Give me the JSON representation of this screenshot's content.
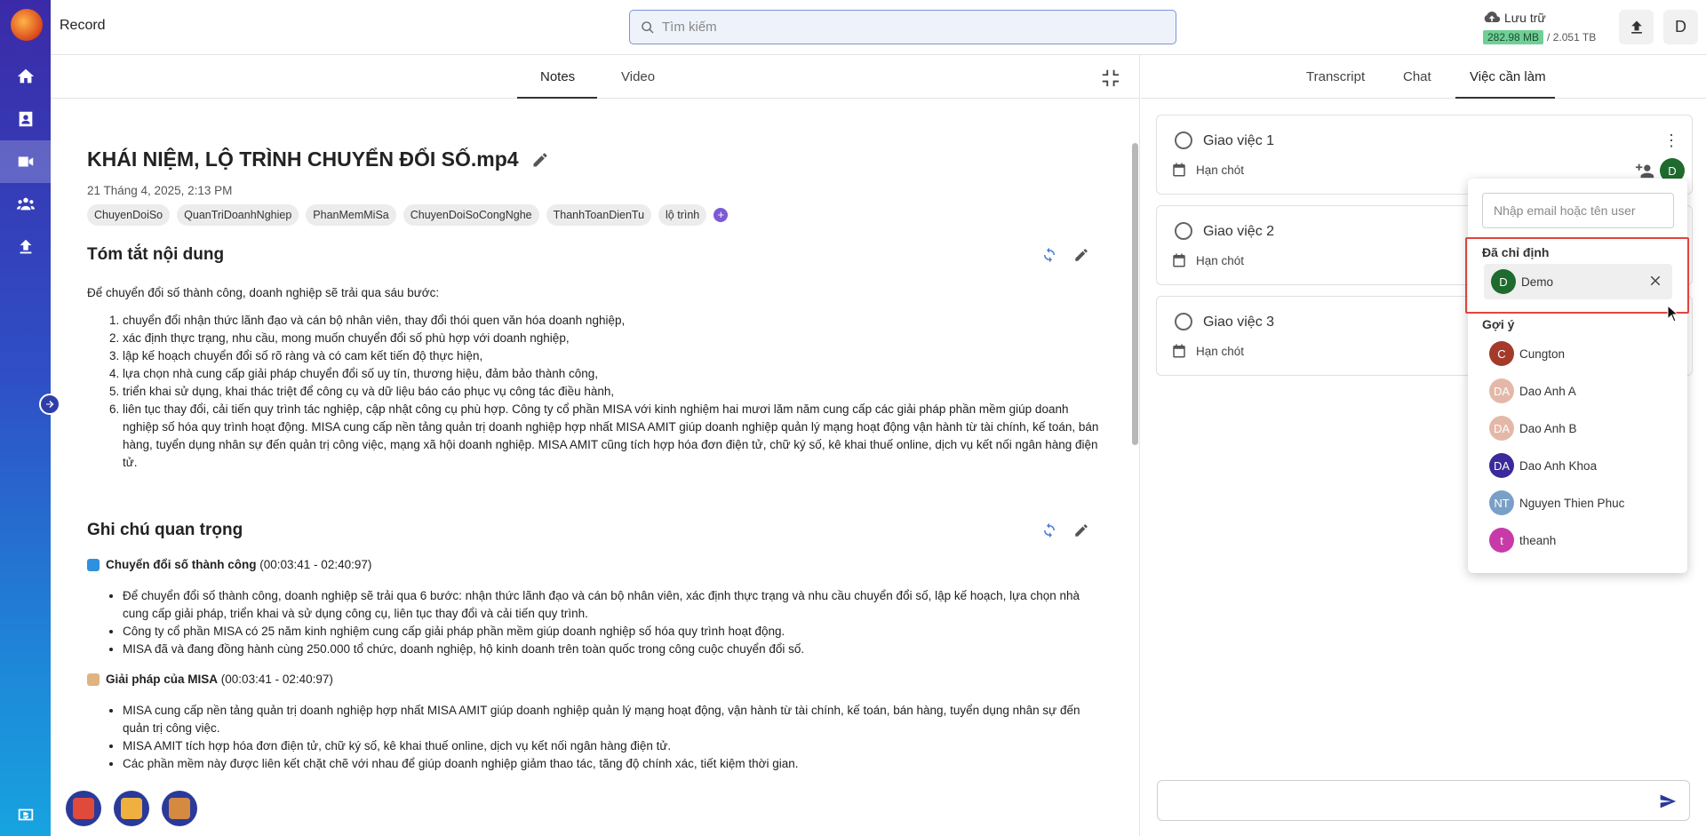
{
  "app": {
    "title": "Record"
  },
  "search": {
    "placeholder": "Tìm kiếm"
  },
  "storage": {
    "label": "Lưu trữ",
    "used": "282.98 MB",
    "total": "/ 2.051 TB"
  },
  "header": {
    "user_initial": "D"
  },
  "left_tabs": [
    {
      "label": "Notes"
    },
    {
      "label": "Video"
    }
  ],
  "right_tabs": [
    {
      "label": "Transcript"
    },
    {
      "label": "Chat"
    },
    {
      "label": "Việc cần làm"
    }
  ],
  "doc": {
    "title": "KHÁI NIỆM, LỘ TRÌNH CHUYỂN ĐỔI SỐ.mp4",
    "date": "21 Tháng 4, 2025, 2:13 PM",
    "tags": [
      "ChuyenDoiSo",
      "QuanTriDoanhNghiep",
      "PhanMemMiSa",
      "ChuyenDoiSoCongNghe",
      "ThanhToanDienTu",
      "lộ trình"
    ]
  },
  "summary": {
    "heading": "Tóm tắt nội dung",
    "intro": "Để chuyển đổi số thành công, doanh nghiệp sẽ trải qua sáu bước:",
    "steps": [
      "chuyển đổi nhận thức lãnh đạo và cán bộ nhân viên, thay đổi thói quen văn hóa doanh nghiệp,",
      "xác định thực trạng, nhu cầu, mong muốn chuyển đổi số phù hợp với doanh nghiệp,",
      "lập kế hoạch chuyển đổi số rõ ràng và có cam kết tiến độ thực hiện,",
      "lựa chọn nhà cung cấp giải pháp chuyển đổi số uy tín, thương hiệu, đảm bảo thành công,",
      "triển khai sử dụng, khai thác triệt để công cụ và dữ liệu báo cáo phục vụ công tác điều hành,",
      "liên tục thay đổi, cải tiến quy trình tác nghiệp, cập nhật công cụ phù hợp. Công ty cổ phần MISA với kinh nghiệm hai mươi lăm năm cung cấp các giải pháp phần mềm giúp doanh nghiệp số hóa quy trình hoạt động. MISA cung cấp nền tảng quản trị doanh nghiệp hợp nhất MISA AMIT giúp doanh nghiệp quản lý mạng hoạt động vận hành từ tài chính, kế toán, bán hàng, tuyển dụng nhân sự đến quản trị công việc, mạng xã hội doanh nghiệp. MISA AMIT cũng tích hợp hóa đơn điện tử, chữ ký số, kê khai thuế online, dịch vụ kết nối ngân hàng điện tử."
    ]
  },
  "notes": {
    "heading": "Ghi chú quan trọng",
    "sections": [
      {
        "title": "Chuyển đổi số thành công",
        "time": "(00:03:41 - 02:40:97)",
        "bullets": [
          "Để chuyển đổi số thành công, doanh nghiệp sẽ trải qua 6 bước: nhận thức lãnh đạo và cán bộ nhân viên, xác định thực trạng và nhu cầu chuyển đổi số, lập kế hoạch, lựa chọn nhà cung cấp giải pháp, triển khai và sử dụng công cụ, liên tục thay đổi và cải tiến quy trình.",
          "Công ty cổ phần MISA có 25 năm kinh nghiệm cung cấp giải pháp phần mềm giúp doanh nghiệp số hóa quy trình hoạt động.",
          "MISA đã và đang đồng hành cùng 250.000 tổ chức, doanh nghiệp, hộ kinh doanh trên toàn quốc trong công cuộc chuyển đổi số."
        ]
      },
      {
        "title": "Giải pháp của MISA",
        "time": "(00:03:41 - 02:40:97)",
        "bullets": [
          "MISA cung cấp nền tảng quản trị doanh nghiệp hợp nhất MISA AMIT giúp doanh nghiệp quản lý mạng hoạt động, vận hành từ tài chính, kế toán, bán hàng, tuyển dụng nhân sự đến quản trị công việc.",
          "MISA AMIT tích hợp hóa đơn điện tử, chữ ký số, kê khai thuế online, dịch vụ kết nối ngân hàng điện tử.",
          "Các phần mềm này được liên kết chặt chẽ với nhau để giúp doanh nghiệp giảm thao tác, tăng độ chính xác, tiết kiệm thời gian."
        ]
      }
    ]
  },
  "tasks": [
    {
      "name": "Giao việc 1",
      "deadline": "Hạn chót",
      "assignee_initial": "D"
    },
    {
      "name": "Giao việc 2",
      "deadline": "Hạn chót"
    },
    {
      "name": "Giao việc 3",
      "deadline": "Hạn chót"
    }
  ],
  "assign_dropdown": {
    "placeholder": "Nhập email hoặc tên user",
    "assigned_label": "Đã chỉ định",
    "assigned": [
      {
        "initial": "D",
        "name": "Demo",
        "color": "#1f6b2e"
      }
    ],
    "suggest_label": "Gợi ý",
    "suggestions": [
      {
        "initial": "C",
        "name": "Cungton",
        "color": "#a33a2a"
      },
      {
        "initial": "DA",
        "name": "Dao Anh A",
        "color": "#e4b8a8"
      },
      {
        "initial": "DA",
        "name": "Dao Anh B",
        "color": "#e4b8a8"
      },
      {
        "initial": "DA",
        "name": "Dao Anh Khoa",
        "color": "#3a2a9a"
      },
      {
        "initial": "NT",
        "name": "Nguyen Thien Phuc",
        "color": "#7aa0c8"
      },
      {
        "initial": "t",
        "name": "theanh",
        "color": "#c83aa8"
      }
    ]
  },
  "colors": {
    "sidebar_top": "#3b2aa8",
    "sidebar_bottom": "#17a3e0",
    "accent": "#2a3a9a",
    "highlight": "#e0443f"
  }
}
